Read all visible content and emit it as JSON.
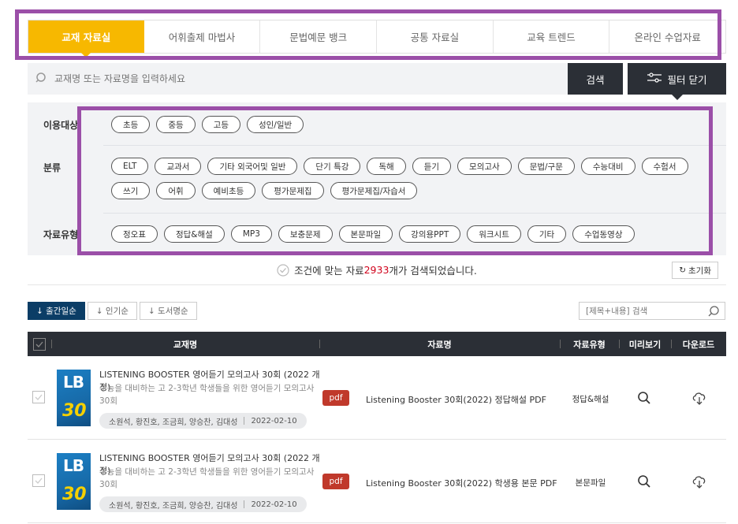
{
  "tabs": [
    {
      "label": "교재 자료실",
      "active": true
    },
    {
      "label": "어휘출제 마법사"
    },
    {
      "label": "문법예문 뱅크"
    },
    {
      "label": "공통 자료실"
    },
    {
      "label": "교육 트렌드"
    },
    {
      "label": "온라인 수업자료"
    }
  ],
  "search": {
    "placeholder": "교재명 또는 자료명을 입력하세요",
    "button": "검색",
    "filter_button": "필터 닫기"
  },
  "filters": {
    "audience": {
      "label": "이용대상",
      "options": [
        "초등",
        "중등",
        "고등",
        "성인/일반"
      ]
    },
    "category": {
      "label": "분류",
      "options": [
        "ELT",
        "교과서",
        "기타 외국어및 일반",
        "단기 특강",
        "독해",
        "듣기",
        "모의고사",
        "문법/구문",
        "수능대비",
        "수험서",
        "쓰기",
        "어휘",
        "예비초등",
        "평가문제집",
        "평가문제집/자습서"
      ]
    },
    "type": {
      "label": "자료유형",
      "options": [
        "정오표",
        "정답&해설",
        "MP3",
        "보충문제",
        "본문파일",
        "강의용PPT",
        "워크시트",
        "기타",
        "수업동영상"
      ]
    }
  },
  "result": {
    "prefix": "조건에 맞는 자료 ",
    "count": "2933",
    "suffix": "개가 검색되었습니다.",
    "reset": "초기화"
  },
  "sort": [
    {
      "label": "↓ 출간일순",
      "active": true
    },
    {
      "label": "↓ 인기순"
    },
    {
      "label": "↓ 도서명순"
    }
  ],
  "mini_search": {
    "placeholder": "[제목+내용] 검색"
  },
  "table": {
    "headers": {
      "book": "교재명",
      "resource": "자료명",
      "type": "자료유형",
      "preview": "미리보기",
      "download": "다운로드"
    },
    "rows": [
      {
        "title": "LISTENING BOOSTER 영어듣기 모의고사 30회 (2022 개정)",
        "desc": "수능을 대비하는 고 2-3학년 학생들을 위한 영어듣기 모의고사 30회",
        "authors": "소원석, 황진호, 조금희, 양승찬, 김대성",
        "date": "2022-02-10",
        "badge": "pdf",
        "resource": "Listening Booster 30회(2022) 정답해설 PDF",
        "type": "정답&해설",
        "cover_lb": "LB",
        "cover_n": "30"
      },
      {
        "title": "LISTENING BOOSTER 영어듣기 모의고사 30회 (2022 개정)",
        "desc": "수능을 대비하는 고 2-3학년 학생들을 위한 영어듣기 모의고사 30회",
        "authors": "소원석, 황진호, 조금희, 양승찬, 김대성",
        "date": "2022-02-10",
        "badge": "pdf",
        "resource": "Listening Booster 30회(2022) 학생용 본문 PDF",
        "type": "본문파일",
        "cover_lb": "LB",
        "cover_n": "30"
      }
    ]
  },
  "colors": {
    "accent": "#f7b800",
    "dark": "#2b2f36",
    "highlight": "#9b4fa8",
    "count": "#d0021b"
  }
}
